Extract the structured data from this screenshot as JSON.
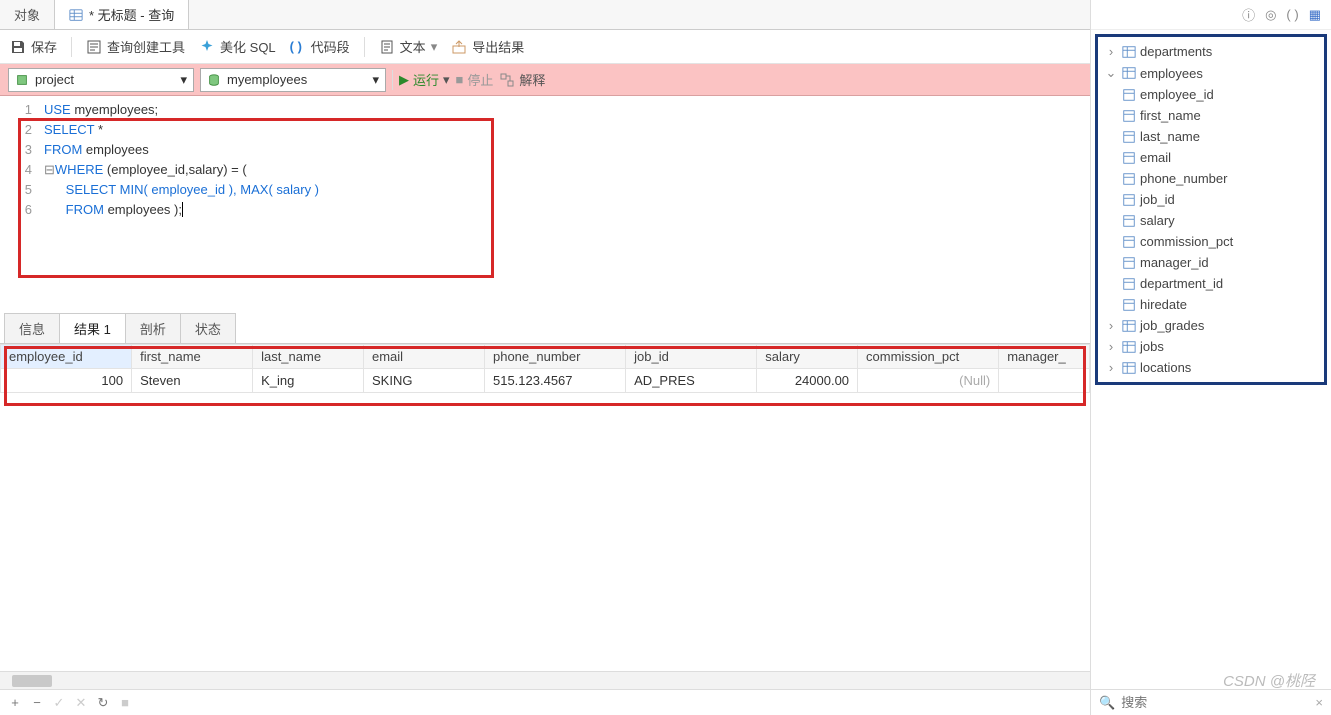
{
  "tabs": {
    "objects": "对象",
    "query": "* 无标题 - 查询"
  },
  "toolbar": {
    "save": "保存",
    "query_builder": "查询创建工具",
    "beautify": "美化 SQL",
    "snippet": "代码段",
    "text": "文本",
    "export": "导出结果"
  },
  "conn": {
    "connection": "project",
    "database": "myemployees",
    "run": "运行",
    "stop": "停止",
    "explain": "解释"
  },
  "sql": {
    "l1": {
      "a": "USE",
      "b": " myemployees;"
    },
    "l2": {
      "a": "SELECT",
      "b": " *"
    },
    "l3": {
      "a": "FROM",
      "b": " employees"
    },
    "l4": {
      "a": "WHERE",
      "b": " (employee_id,salary) = ("
    },
    "l5": {
      "a": "SELECT",
      "b": " MIN( employee_id ), MAX( salary )"
    },
    "l6": {
      "a": "FROM",
      "b": " employees );"
    }
  },
  "result_tabs": {
    "info": "信息",
    "result1": "结果 1",
    "profile": "剖析",
    "status": "状态"
  },
  "columns": {
    "employee_id": "employee_id",
    "first_name": "first_name",
    "last_name": "last_name",
    "email": "email",
    "phone_number": "phone_number",
    "job_id": "job_id",
    "salary": "salary",
    "commission_pct": "commission_pct",
    "manager_": "manager_"
  },
  "row": {
    "employee_id": "100",
    "first_name": "Steven",
    "last_name": "K_ing",
    "email": "SKING",
    "phone_number": "515.123.4567",
    "job_id": "AD_PRES",
    "salary": "24000.00",
    "commission_pct": "(Null)",
    "manager_": ""
  },
  "tree": {
    "departments": "departments",
    "employees": "employees",
    "cols": {
      "employee_id": "employee_id",
      "first_name": "first_name",
      "last_name": "last_name",
      "email": "email",
      "phone_number": "phone_number",
      "job_id": "job_id",
      "salary": "salary",
      "commission_pct": "commission_pct",
      "manager_id": "manager_id",
      "department_id": "department_id",
      "hiredate": "hiredate"
    },
    "job_grades": "job_grades",
    "jobs": "jobs",
    "locations": "locations"
  },
  "search": {
    "placeholder": "搜索"
  },
  "watermark": "CSDN @桃陉"
}
